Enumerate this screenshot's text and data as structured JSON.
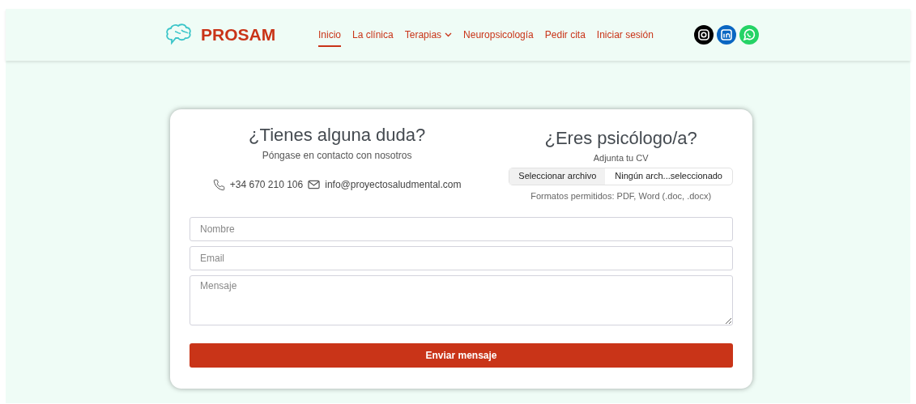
{
  "brand": {
    "name": "PROSAM"
  },
  "nav": [
    {
      "label": "Inicio",
      "selected": true,
      "dropdown": false
    },
    {
      "label": "La clínica",
      "selected": false,
      "dropdown": false
    },
    {
      "label": "Terapias",
      "selected": false,
      "dropdown": true
    },
    {
      "label": "Neuropsicología",
      "selected": false,
      "dropdown": false
    },
    {
      "label": "Pedir cita",
      "selected": false,
      "dropdown": false
    },
    {
      "label": "Iniciar sesión",
      "selected": false,
      "dropdown": false
    }
  ],
  "social": [
    {
      "kind": "instagram",
      "color": "#000000"
    },
    {
      "kind": "linkedin",
      "color": "#0a66c2"
    },
    {
      "kind": "whatsapp",
      "color": "#25d366"
    }
  ],
  "contact": {
    "title": "¿Tienes alguna duda?",
    "subtitle": "Póngase en contacto con nosotros",
    "phone": "+34 670 210 106",
    "email": "info@proyectosaludmental.com"
  },
  "cv": {
    "title": "¿Eres psicólogo/a?",
    "subtitle": "Adjunta tu CV",
    "file_button": "Seleccionar archivo",
    "file_status": "Ningún arch...seleccionado",
    "hint": "Formatos permitidos: PDF, Word (.doc, .docx)"
  },
  "form": {
    "fields": [
      {
        "kind": "input",
        "placeholder": "Nombre"
      },
      {
        "kind": "input",
        "placeholder": "Email"
      },
      {
        "kind": "textarea",
        "placeholder": "Mensaje"
      }
    ],
    "submit": "Enviar mensaje"
  }
}
